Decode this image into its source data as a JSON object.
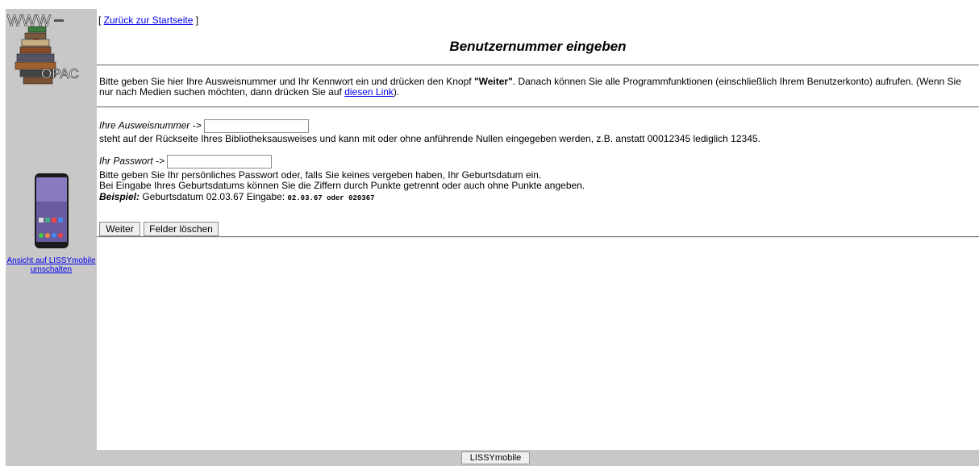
{
  "sidebar": {
    "logo_top": "WWW",
    "logo_bottom": "OPAC",
    "mobile_link": "Ansicht auf LISSYmobile umschalten"
  },
  "header": {
    "back_link": "Zurück zur Startseite",
    "title": "Benutzernummer eingeben"
  },
  "intro": {
    "text_1": "Bitte geben Sie hier Ihre Ausweisnummer und Ihr Kennwort ein und drücken den Knopf ",
    "bold": "\"Weiter\"",
    "text_2": ". Danach können Sie alle Programmfunktionen (einschließlich Ihrem Benutzerkonto) aufrufen. (Wenn Sie nur nach Medien suchen möchten, dann drücken Sie auf ",
    "link": "diesen Link",
    "text_3": ")."
  },
  "form": {
    "id_label": "Ihre Ausweisnummer ->",
    "id_value": "",
    "id_hint": "steht auf der Rückseite Ihres Bibliotheksausweises und kann mit oder ohne anführende Nullen eingegeben werden, z.B. anstatt 00012345 lediglich 12345.",
    "pw_label": "Ihr Passwort ->",
    "pw_value": "",
    "pw_hint_1": "Bitte geben Sie Ihr persönliches Passwort oder, falls Sie keines vergeben haben, Ihr Geburtsdatum ein.",
    "pw_hint_2": "Bei Eingabe Ihres Geburtsdatums können Sie die Ziffern durch Punkte getrennt oder auch ohne Punkte angeben.",
    "example_label": "Beispiel:",
    "example_text": " Geburtsdatum 02.03.67 Eingabe: ",
    "example_mono": "02.03.67 oder 020367",
    "submit": "Weiter",
    "reset": "Felder löschen"
  },
  "footer": {
    "label": "LISSYmobile"
  },
  "colors": {
    "sidebar_bg": "#c8c8c8",
    "link": "#0000ee"
  }
}
